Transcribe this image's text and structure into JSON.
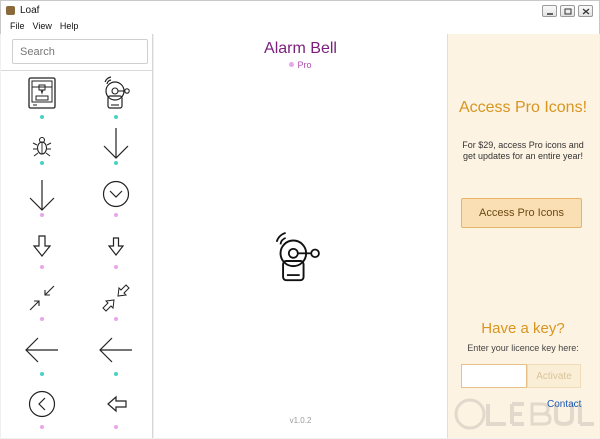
{
  "window": {
    "title": "Loaf"
  },
  "menu": [
    "File",
    "View",
    "Help"
  ],
  "search": {
    "placeholder": "Search",
    "value": ""
  },
  "sidebar_icons": [
    {
      "name": "3d-printer-icon",
      "dot": "#4ad0c8"
    },
    {
      "name": "alarm-bell-icon",
      "dot": "#4ad0c8"
    },
    {
      "name": "bug-icon",
      "dot": "#4ad0c8"
    },
    {
      "name": "arrow-down-icon",
      "dot": "#4ad0c8"
    },
    {
      "name": "arrow-down-long-icon",
      "dot": "#e9a6e9"
    },
    {
      "name": "arrow-down-circle-icon",
      "dot": "#e9a6e9"
    },
    {
      "name": "arrow-down-outline-icon",
      "dot": "#e9a6e9"
    },
    {
      "name": "arrow-down-outline-small-icon",
      "dot": "#e9a6e9"
    },
    {
      "name": "arrows-shrink-icon",
      "dot": "#e9a6e9"
    },
    {
      "name": "arrows-shrink-outline-icon",
      "dot": "#e9a6e9"
    },
    {
      "name": "arrow-left-icon",
      "dot": "#4ad0c8"
    },
    {
      "name": "arrow-left-long-icon",
      "dot": "#4ad0c8"
    },
    {
      "name": "arrow-left-circle-icon",
      "dot": "#e9a6e9"
    },
    {
      "name": "arrow-left-outline-icon",
      "dot": "#e9a6e9"
    }
  ],
  "preview": {
    "title": "Alarm Bell",
    "tier": "Pro",
    "icon": "alarm-bell-icon",
    "version": "v1.0.2"
  },
  "pro_panel": {
    "title": "Access Pro Icons!",
    "description": "For $29, access Pro icons and get updates for an entire year!",
    "button": "Access Pro Icons",
    "key_title": "Have a key?",
    "key_prompt": "Enter your licence key here:",
    "key_value": "",
    "activate": "Activate",
    "contact": "Contact"
  },
  "colors": {
    "accent": "#d8951f",
    "title": "#7a1f7a",
    "free_dot": "#4ad0c8",
    "pro_dot": "#e9a6e9"
  }
}
